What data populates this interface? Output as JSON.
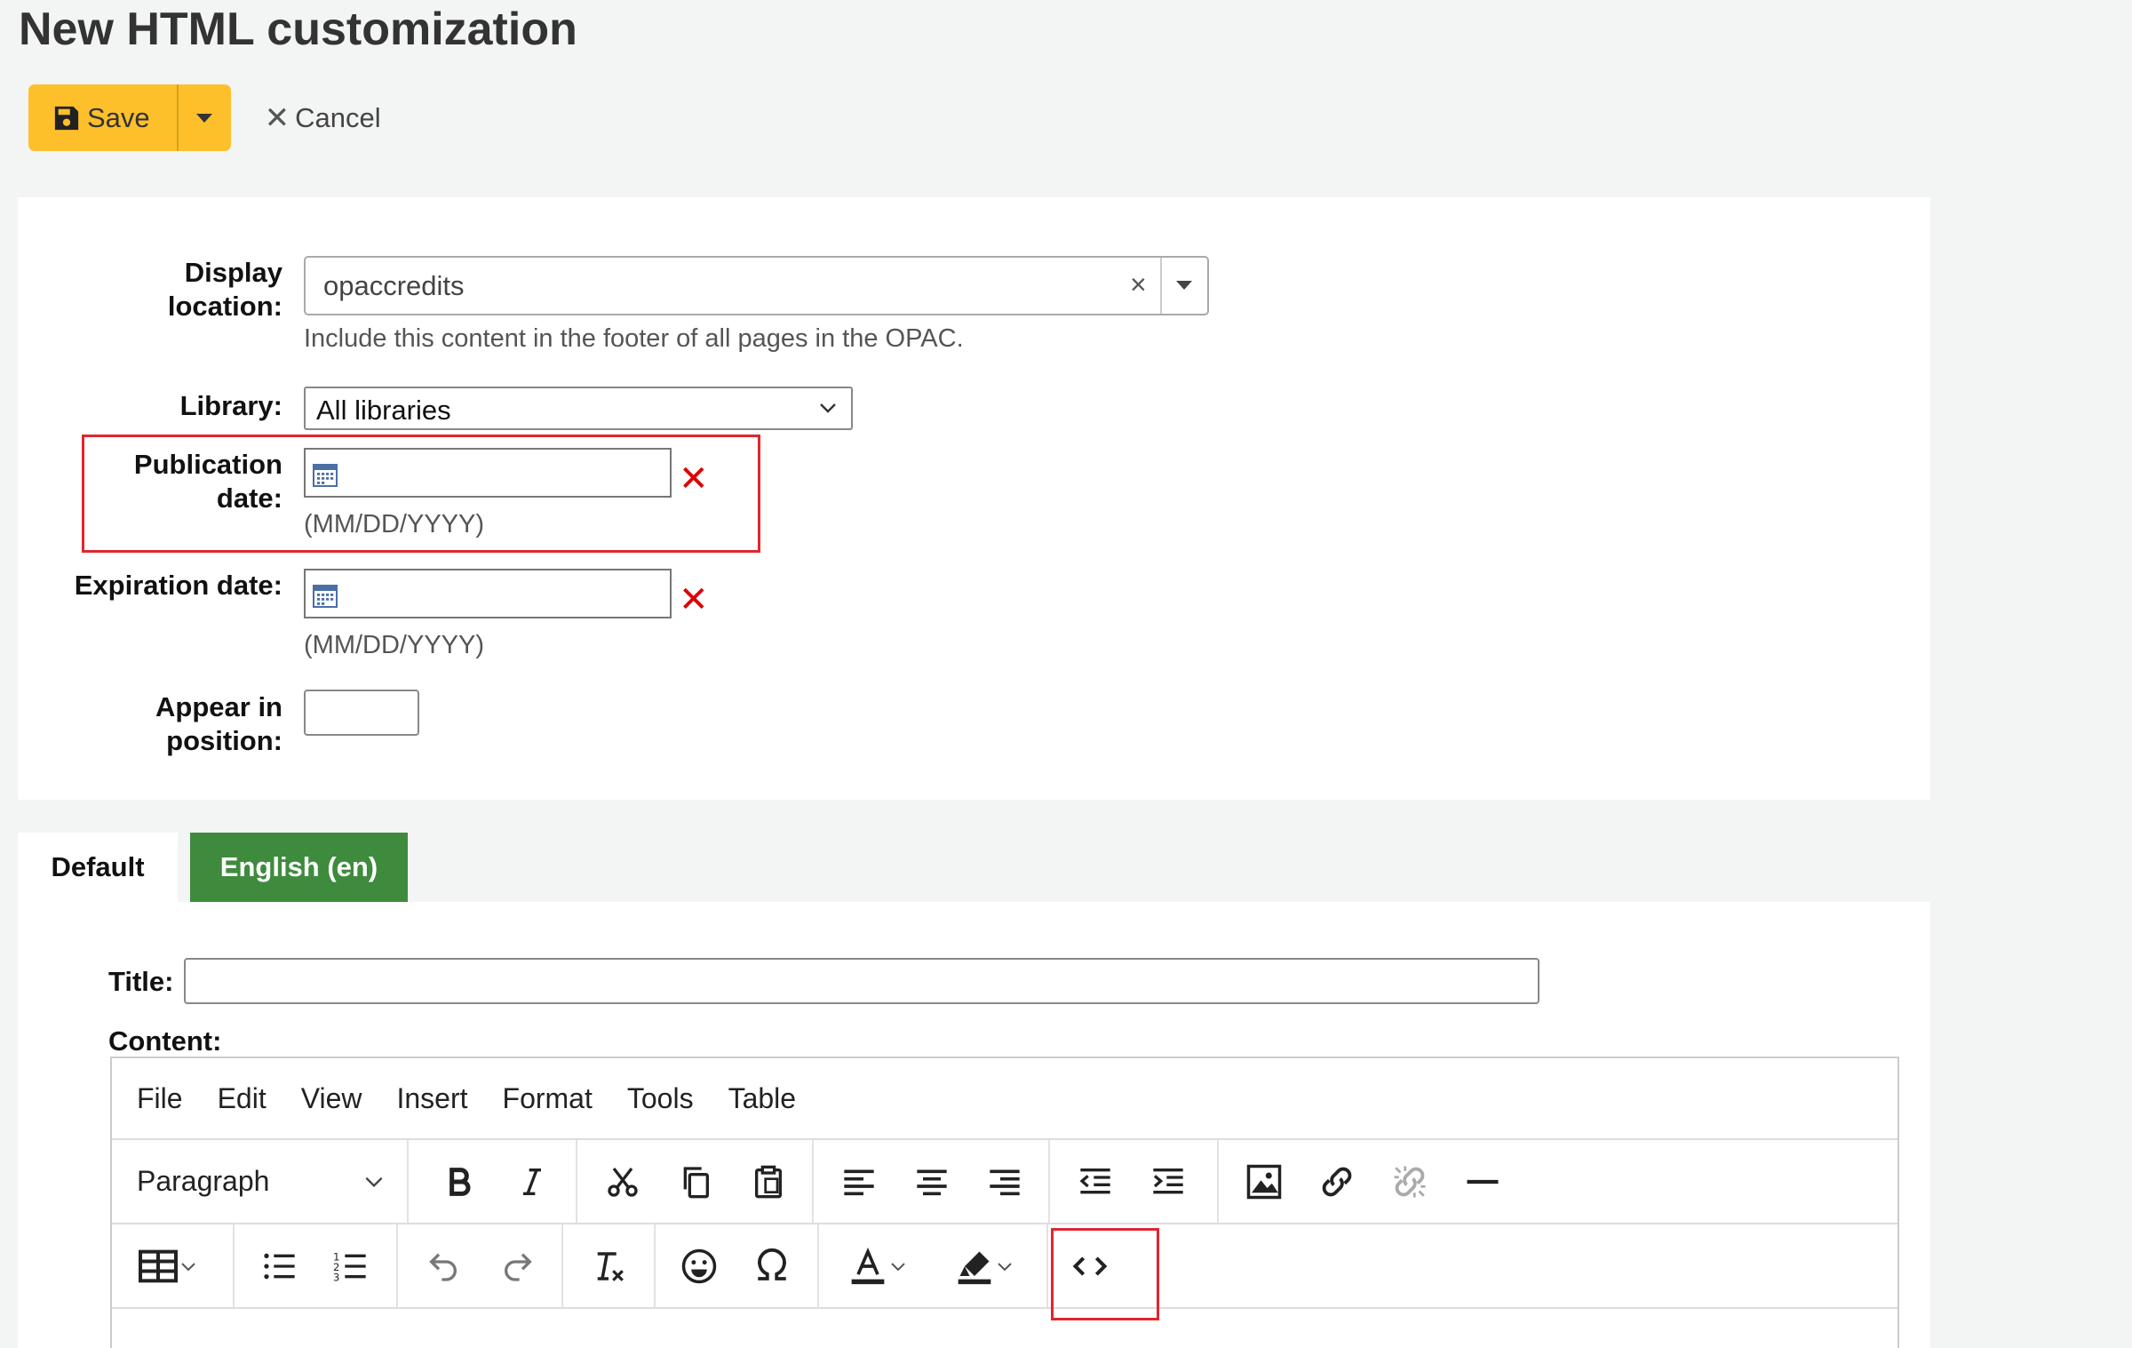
{
  "page": {
    "title": "New HTML customization"
  },
  "toolbar": {
    "save_label": "Save",
    "cancel_label": "Cancel"
  },
  "form": {
    "display_location": {
      "label_line1": "Display",
      "label_line2": "location:",
      "value": "opaccredits",
      "hint": "Include this content in the footer of all pages in the OPAC."
    },
    "library": {
      "label": "Library:",
      "value": "All libraries"
    },
    "publication_date": {
      "label_line1": "Publication",
      "label_line2": "date:",
      "value": "",
      "hint": "(MM/DD/YYYY)"
    },
    "expiration_date": {
      "label": "Expiration date:",
      "value": "",
      "hint": "(MM/DD/YYYY)"
    },
    "position": {
      "label_line1": "Appear in",
      "label_line2": "position:",
      "value": ""
    }
  },
  "tabs": [
    {
      "label": "Default",
      "active": true
    },
    {
      "label": "English (en)",
      "active": false
    }
  ],
  "content": {
    "title_label": "Title:",
    "title_value": "",
    "content_label": "Content:"
  },
  "editor": {
    "menu": [
      "File",
      "Edit",
      "View",
      "Insert",
      "Format",
      "Tools",
      "Table"
    ],
    "block_format": "Paragraph"
  },
  "colors": {
    "save_button": "#fdc02b",
    "active_tab_green": "#3e8b3e",
    "highlight_red": "#e0262f",
    "clear_red": "#dd0000"
  }
}
